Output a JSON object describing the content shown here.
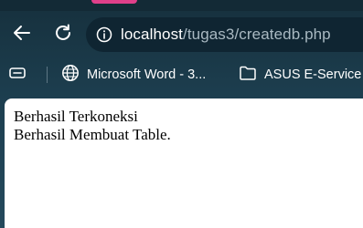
{
  "browser": {
    "address_bar": {
      "host": "localhost",
      "path": "/tugas3/createdb.php"
    },
    "bookmarks": [
      {
        "icon": "globe-icon",
        "label": "Microsoft Word - 3..."
      },
      {
        "icon": "folder-icon",
        "label": "ASUS E-Service"
      }
    ],
    "icons": {
      "back": "back-arrow-icon",
      "reload": "reload-icon",
      "site_info": "info-icon",
      "apps": "apps-icon"
    }
  },
  "page": {
    "lines": [
      "Berhasil Terkoneksi",
      "Berhasil Membuat Table."
    ]
  },
  "colors": {
    "chrome_background": "#1d3f50",
    "omnibox_background": "#0f2532",
    "url_path": "#a9b9c2",
    "tab_accent": "#e0408a",
    "page_background": "#ffffff"
  }
}
